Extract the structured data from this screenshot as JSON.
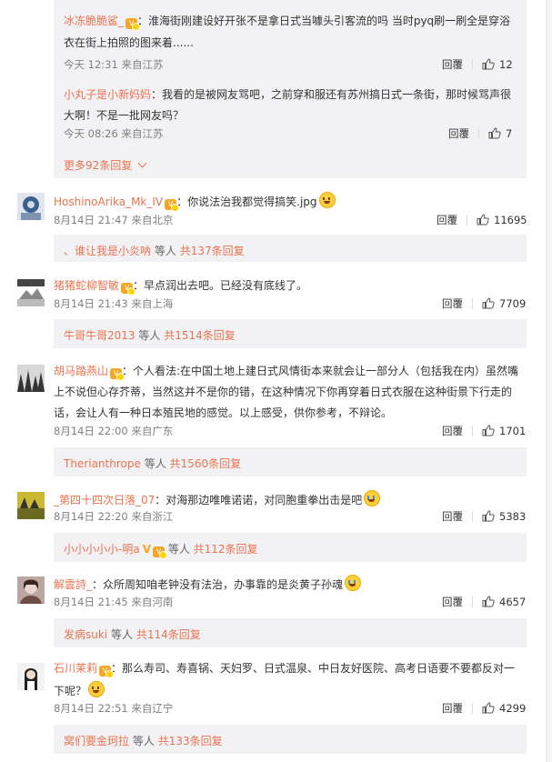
{
  "colors": {
    "name": "#eb7350",
    "panel_bg": "#f2f2f5",
    "time": "#808080"
  },
  "top_panel": {
    "reply1": {
      "user": "冰冻脆脆鲨_",
      "text_line1": "：淮海街刚建设好开张不是拿日式当噱头引客流的吗 当时pyq刷一刷全是穿浴",
      "text_line2": "衣在街上拍照的图来着......",
      "time": "今天 12:31 来自江苏",
      "reply_label": "回覆",
      "likes": "12"
    },
    "reply2": {
      "user": "小丸子是小新妈妈",
      "text_line1": "：我看的是被网友骂吧，之前穿和服还有苏州搞日式一条街，那时候骂声很",
      "text_line2": "大啊！不是一批网友吗？",
      "time": "今天 08:26 来自江苏",
      "reply_label": "回覆",
      "likes": "7"
    },
    "more_label": "更多92条回复"
  },
  "comments": [
    {
      "user": "HoshinoArika_Mk_IV",
      "text": "：你说法治我都觉得搞笑.jpg",
      "time": "8月14日 21:47 来自北京",
      "reply_label": "回覆",
      "likes": "11695",
      "sub_user": "、谁让我是小炎呐",
      "sub_mid": "等人",
      "sub_count": "共137条回复"
    },
    {
      "user": "猪猪蛇柳智敏",
      "text": "：早点润出去吧。已经没有底线了。",
      "time": "8月14日 21:43 来自上海",
      "reply_label": "回覆",
      "likes": "7709",
      "sub_user": "牛哥牛哥2013",
      "sub_mid": "等人",
      "sub_count": "共1514条回复"
    },
    {
      "user": "胡马踏燕山",
      "text_line1": "：个人看法:在中国土地上建日式风情街本来就会让一部分人（包括我在内）虽然嘴",
      "text_line2": "上不说但心存芥蒂，当然这并不是你的错，在这种情况下你再穿着日式衣服在这种街景下行走的",
      "text_line3": "话，会让人有一种日本殖民地的感觉。以上感受，供你参考，不辩论。",
      "time": "8月14日 22:00 来自广东",
      "reply_label": "回覆",
      "likes": "1701",
      "sub_user": "Therianthrope",
      "sub_mid": "等人",
      "sub_count": "共1560条回复"
    },
    {
      "user": "_第四十四次日落_07",
      "text": "：对海那边唯唯诺诺，对同胞重拳出击是吧",
      "time": "8月14日 22:20 来自浙江",
      "reply_label": "回覆",
      "likes": "5383",
      "sub_user": "小小小小小-明a",
      "sub_mid": "等人",
      "sub_count": "共112条回复"
    },
    {
      "user": "解雲詩_",
      "text": "：众所周知咱老钟没有法治，办事靠的是炎黄子孙魂",
      "time": "8月14日 21:45 来自河南",
      "reply_label": "回覆",
      "likes": "4657",
      "sub_user": "发病suki",
      "sub_mid": "等人",
      "sub_count": "共114条回复"
    },
    {
      "user": "石川茉莉",
      "text_line1": "：那么寿司、寿喜锅、天妇罗、日式温泉、中日友好医院、高考日语要不要都反对一",
      "text_line2": "下呢？",
      "time": "8月14日 22:51 来自辽宁",
      "reply_label": "回覆",
      "likes": "4299",
      "sub_user": "窝们要金珂拉",
      "sub_mid": "等人",
      "sub_count": "共133条回复"
    }
  ]
}
